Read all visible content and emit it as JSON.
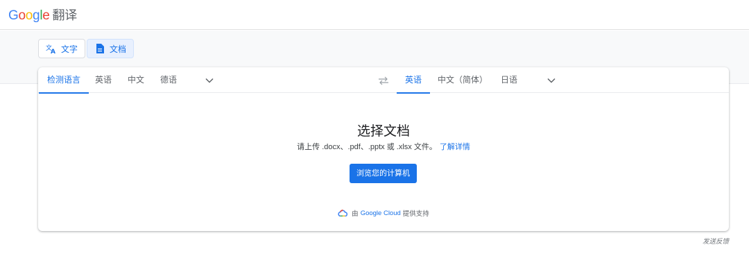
{
  "header": {
    "logo_letters": [
      "G",
      "o",
      "o",
      "g",
      "l",
      "e"
    ],
    "product": "翻译"
  },
  "modes": [
    {
      "label": "文字",
      "icon": "translate-icon",
      "active": false
    },
    {
      "label": "文档",
      "icon": "document-icon",
      "active": true
    }
  ],
  "source_langs": {
    "items": [
      "检测语言",
      "英语",
      "中文",
      "德语"
    ],
    "selected": "检测语言"
  },
  "target_langs": {
    "items": [
      "英语",
      "中文（简体）",
      "日语"
    ],
    "selected": "英语"
  },
  "upload": {
    "title": "选择文档",
    "description": "请上传 .docx、.pdf、.pptx 或 .xlsx 文件。",
    "learn_more": "了解详情",
    "browse_button": "浏览您的计算机"
  },
  "powered_by": {
    "prefix": "由",
    "brand": "Google Cloud",
    "suffix": "提供支持"
  },
  "feedback": "发送反馈",
  "colors": {
    "accent": "#1a73e8"
  }
}
